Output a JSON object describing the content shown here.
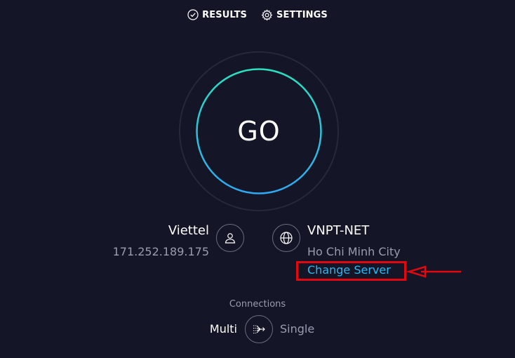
{
  "nav": {
    "results_label": "RESULTS",
    "settings_label": "SETTINGS",
    "results_icon": "check-circle-icon",
    "settings_icon": "gear-icon"
  },
  "go_button": {
    "label": "GO"
  },
  "provider": {
    "name": "Viettel",
    "ip": "171.252.189.175",
    "icon": "user-icon"
  },
  "server": {
    "name": "VNPT-NET",
    "location": "Ho Chi Minh City",
    "change_label": "Change Server",
    "icon": "globe-icon"
  },
  "connections": {
    "label": "Connections",
    "multi_label": "Multi",
    "single_label": "Single",
    "selected": "Multi",
    "icon": "connections-toggle-icon"
  },
  "colors": {
    "background": "#141526",
    "accent_link": "#2fb7f1",
    "ring_start": "#2ae0c0",
    "ring_end": "#2fa8f1",
    "annotation": "#e3070f",
    "muted_text": "#9a9cb0"
  }
}
